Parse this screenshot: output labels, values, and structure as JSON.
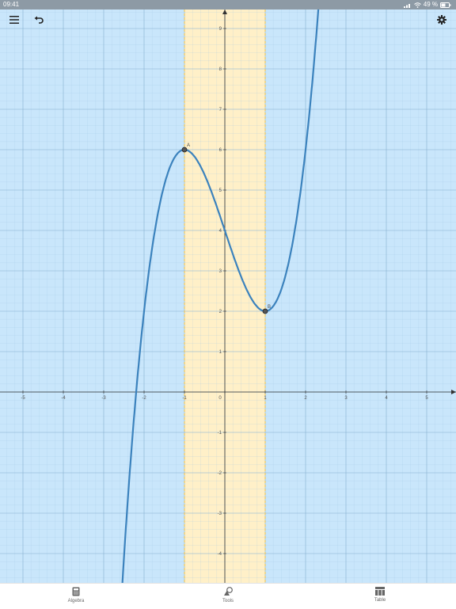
{
  "status": {
    "time": "09:41",
    "battery": "49 %"
  },
  "toolbar": {
    "menu_icon": "menu-icon",
    "undo_icon": "undo-icon",
    "settings_icon": "settings-icon"
  },
  "graph": {
    "x_ticks": [
      "-5",
      "-4",
      "-3",
      "-2",
      "-1",
      "0",
      "1",
      "2",
      "3",
      "4",
      "5"
    ],
    "y_ticks_pos": [
      "1",
      "2",
      "3",
      "4",
      "5",
      "6",
      "7",
      "8",
      "9"
    ],
    "y_ticks_neg": [
      "-1",
      "-2",
      "-3",
      "-4"
    ],
    "points": [
      {
        "label": "A",
        "x": -1,
        "y": 6
      },
      {
        "label": "B",
        "x": 1,
        "y": 2
      }
    ],
    "shaded_interval": [
      -1,
      1
    ],
    "colors": {
      "background": "#c9e6fb",
      "curve": "#3b82bd",
      "shade": "#fff0c8",
      "shade_border": "#f0c24a"
    }
  },
  "bottom_nav": [
    {
      "label": "Algebra",
      "icon": "calculator-icon"
    },
    {
      "label": "Tools",
      "icon": "shapes-icon"
    },
    {
      "label": "Table",
      "icon": "table-icon"
    }
  ]
}
